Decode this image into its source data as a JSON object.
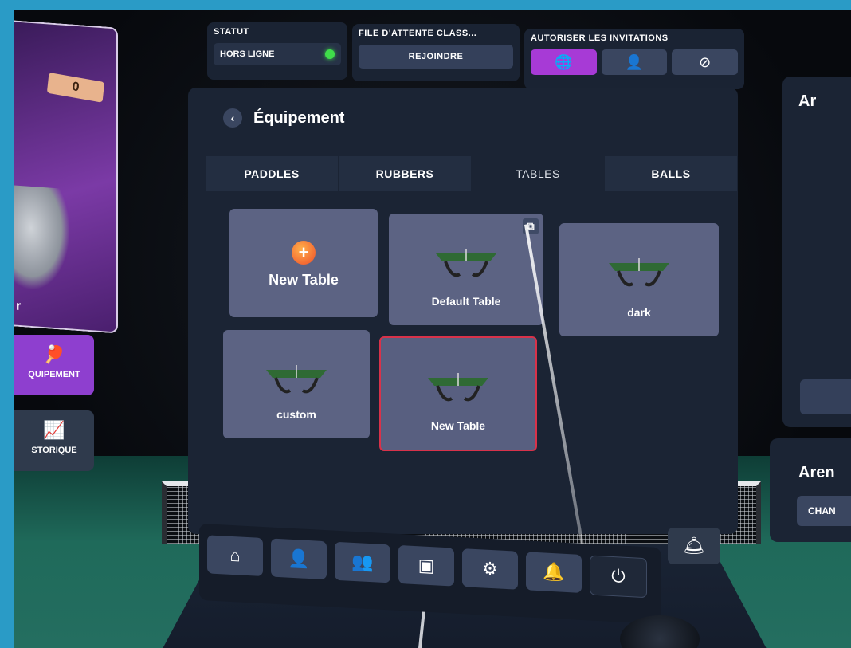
{
  "profile": {
    "score": "0",
    "name_fragment": "r",
    "menu": [
      {
        "label": "QUIPEMENT",
        "icon": "paddle-ball-icon"
      },
      {
        "label": "STORIQUE",
        "icon": "chart-trend-icon"
      }
    ]
  },
  "topbar": {
    "statut": {
      "header": "STATUT",
      "value": "HORS LIGNE",
      "indicator_color": "#3fdc4a"
    },
    "queue": {
      "header": "FILE D'ATTENTE CLASS...",
      "button": "REJOINDRE"
    },
    "invites": {
      "header": "AUTORISER LES INVITATIONS",
      "options": [
        "globe-icon",
        "friend-icon",
        "block-icon"
      ],
      "selected": 0
    }
  },
  "equipment": {
    "title": "Équipement",
    "tabs": [
      "PADDLES",
      "RUBBERS",
      "TABLES",
      "BALLS"
    ],
    "active_tab": "TABLES",
    "cards": [
      {
        "label": "New Table",
        "type": "new"
      },
      {
        "label": "Default Table",
        "type": "table",
        "copy_icon": true
      },
      {
        "label": "dark",
        "type": "table"
      },
      {
        "label": "custom",
        "type": "table"
      },
      {
        "label": "New Table",
        "type": "table",
        "selected": true
      }
    ]
  },
  "right": {
    "title_fragment": "Ar",
    "title2_fragment": "Aren",
    "button_fragment": "CHAN"
  },
  "toolbar": {
    "buttons": [
      "home-icon",
      "profile-icon",
      "friends-icon",
      "book-map-icon",
      "settings-icon",
      "bell-icon",
      "power-icon"
    ],
    "floating": "bell-alert-icon"
  },
  "colors": {
    "accent": "#a73ad6",
    "panel": "#1b2434",
    "card": "#5c6383",
    "selected_border": "#d8324a"
  }
}
